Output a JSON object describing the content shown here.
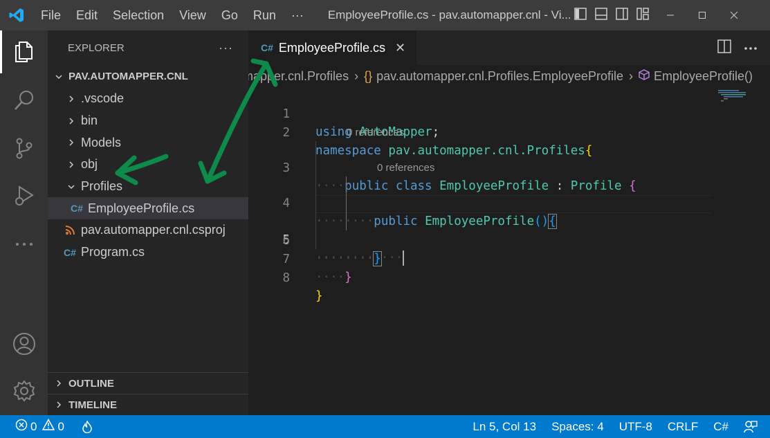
{
  "titlebar": {
    "menu": [
      "File",
      "Edit",
      "Selection",
      "View",
      "Go",
      "Run",
      "···"
    ],
    "title": "EmployeeProfile.cs - pav.automapper.cnl - Vi..."
  },
  "activitybar": {
    "icons": [
      "explorer-icon",
      "search-icon",
      "source-control-icon",
      "run-debug-icon",
      "more-icon",
      "account-icon",
      "settings-gear-icon"
    ]
  },
  "sidebar": {
    "header": "EXPLORER",
    "more": "···",
    "root": "PAV.AUTOMAPPER.CNL",
    "items": [
      {
        "label": ".vscode",
        "type": "folder",
        "expanded": false
      },
      {
        "label": "bin",
        "type": "folder",
        "expanded": false
      },
      {
        "label": "Models",
        "type": "folder",
        "expanded": false
      },
      {
        "label": "obj",
        "type": "folder",
        "expanded": false
      },
      {
        "label": "Profiles",
        "type": "folder",
        "expanded": true
      },
      {
        "label": "EmployeeProfile.cs",
        "type": "csharp",
        "selected": true
      },
      {
        "label": "pav.automapper.cnl.csproj",
        "type": "rss"
      },
      {
        "label": "Program.cs",
        "type": "csharp"
      }
    ],
    "outline": "OUTLINE",
    "timeline": "TIMELINE"
  },
  "editor": {
    "tab": {
      "icon": "C#",
      "label": "EmployeeProfile.cs",
      "close": "✕"
    },
    "breadcrumb": {
      "part1": "mapper.cnl.Profiles",
      "part2": "pav.automapper.cnl.Profiles.EmployeeProfile",
      "part3": "EmployeeProfile()"
    },
    "codelens": "0 references",
    "line_numbers": [
      "1",
      "2",
      "3",
      "4",
      "5",
      "6",
      "7",
      "8"
    ],
    "code": {
      "l1_kw": "using",
      "l1_ns": "AutoMapper",
      "l1_end": ";",
      "l2_kw": "namespace",
      "l2_ns": "pav.automapper.cnl.Profiles",
      "l2_brace": "{",
      "l3_kw": "public class",
      "l3_ty": "EmployeeProfile",
      "l3_colon": " : ",
      "l3_base": "Profile",
      "l3_brace": "{",
      "l4_kw": "public",
      "l4_name": "EmployeeProfile",
      "l4_parens": "()",
      "l4_brace": "{",
      "l6_brace": "}",
      "l7_brace": "}",
      "l8_brace": "}"
    }
  },
  "statusbar": {
    "errors": "0",
    "warnings": "0",
    "position": "Ln 5, Col 13",
    "spaces": "Spaces: 4",
    "encoding": "UTF-8",
    "eol": "CRLF",
    "language": "C#"
  },
  "colors": {
    "accent": "#007acc",
    "annotation": "#0e8a4a"
  }
}
